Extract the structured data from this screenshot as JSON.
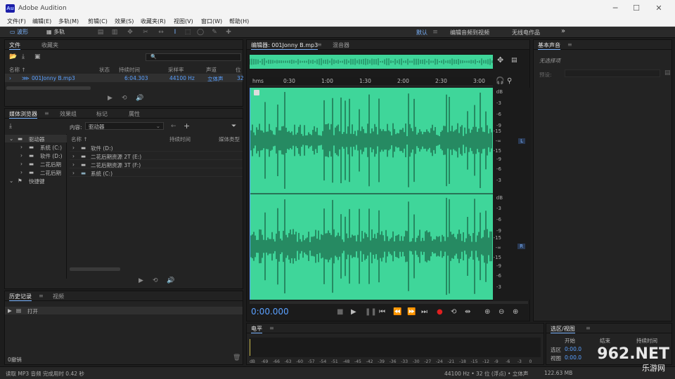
{
  "window": {
    "title": "Adobe Audition",
    "logo": "Au"
  },
  "menu": [
    "文件(F)",
    "编辑(E)",
    "多轨(M)",
    "剪辑(C)",
    "效果(S)",
    "收藏夹(R)",
    "视图(V)",
    "窗口(W)",
    "帮助(H)"
  ],
  "toolbar": {
    "waveform_label": "波形",
    "multitrack_label": "多轨"
  },
  "workspaces": {
    "default": "默认",
    "edit_video": "编辑音频到视频",
    "radio": "无线电作品",
    "more": "»"
  },
  "files_panel": {
    "tabs": [
      "文件",
      "收藏夹"
    ],
    "columns": [
      "名称 ↑",
      "状态",
      "持续时间",
      "采样率",
      "声道",
      "位"
    ],
    "row": {
      "name": "001Jonny B.mp3",
      "duration": "6:04.303",
      "rate": "44100 Hz",
      "channels": "立体声",
      "bits": "32"
    },
    "search_placeholder": "🔍"
  },
  "media_panel": {
    "tabs": [
      "媒体浏览器",
      "效果组",
      "标记",
      "属性"
    ],
    "content_label": "内容:",
    "content_value": "驱动器",
    "tree": [
      "驱动器",
      "系统 (C:)",
      "软件 (D:)",
      "二花后期",
      "二花后期",
      "快捷键"
    ],
    "columns": [
      "名称 ↑",
      "持续时间",
      "媒体类型"
    ],
    "rows": [
      "软件 (D:)",
      "二花后期资源 2T (E:)",
      "二花后期资源 3T (F:)",
      "系统 (C:)"
    ]
  },
  "history_panel": {
    "tabs": [
      "历史记录",
      "视频"
    ],
    "item": "打开",
    "undo": "0撤销"
  },
  "editor": {
    "tabs": [
      "编辑器: 001Jonny B.mp3",
      "混音器"
    ],
    "ruler": [
      "hms",
      "0:30",
      "1:00",
      "1:30",
      "2:00",
      "2:30",
      "3:00"
    ],
    "db_unit": "dB",
    "db_scale": [
      "-3",
      "-6",
      "-9",
      "-15",
      "-∞",
      "-15",
      "-9",
      "-6",
      "-3"
    ],
    "channel_left": "L",
    "channel_right": "R",
    "time": "0:00.000"
  },
  "essential_panel": {
    "title": "基本声音",
    "no_selection": "无选择项",
    "preset_label": "预设:"
  },
  "levels_panel": {
    "title": "电平",
    "scale": [
      "dB",
      "-69",
      "-66",
      "-63",
      "-60",
      "-57",
      "-54",
      "-51",
      "-48",
      "-45",
      "-42",
      "-39",
      "-36",
      "-33",
      "-30",
      "-27",
      "-24",
      "-21",
      "-18",
      "-15",
      "-12",
      "-9",
      "-6",
      "-3",
      "0"
    ]
  },
  "selection_panel": {
    "title": "选区/视图",
    "start": "开始",
    "end": "结束",
    "duration": "持续时间",
    "selection": "选区",
    "view": "视图",
    "sel_val": "0:00.0",
    "view_val": "0:00.0"
  },
  "status": {
    "left": "读取 MP3 音频 完成用时 0.42 秒",
    "right": "44100 Hz • 32 位 (浮点) • 立体声",
    "size": "122.63 MB"
  },
  "brand": {
    "name": "962.NET",
    "sub": "乐游网"
  },
  "colors": {
    "accent": "#7ab4ff",
    "waveform": "#3fd69a",
    "time": "#5aa0ff",
    "record": "#e02020"
  }
}
